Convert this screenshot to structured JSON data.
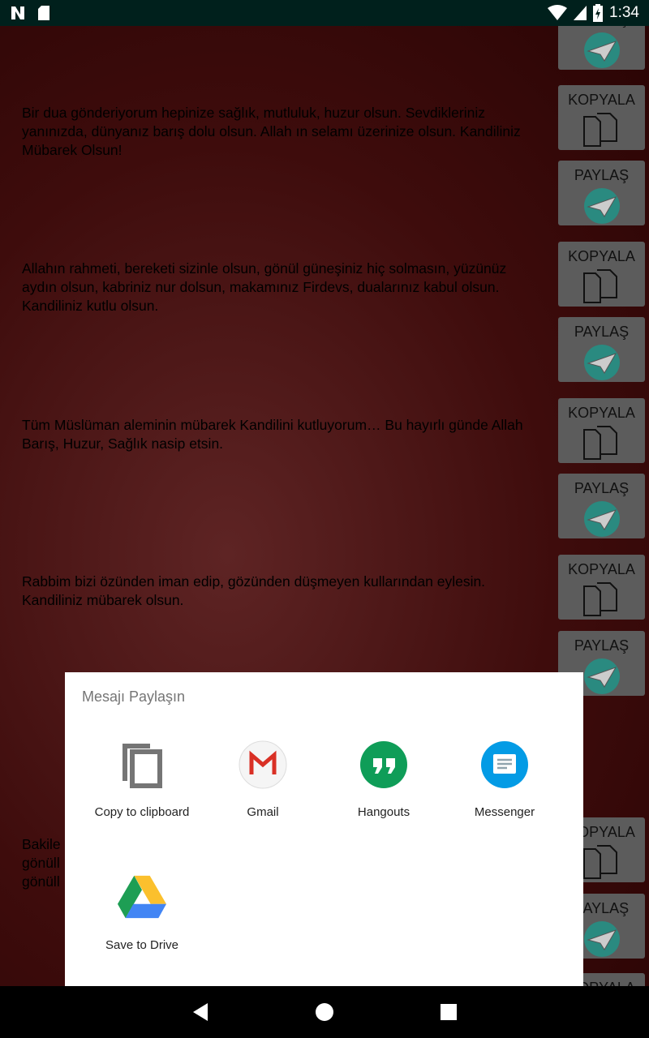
{
  "status_bar": {
    "time": "1:34",
    "icons": [
      "n-icon",
      "sd-card-icon",
      "wifi-icon",
      "signal-icon",
      "battery-charging-icon"
    ]
  },
  "messages": [
    "Bir dua gönderiyorum hepinize sağlık, mutluluk, huzur olsun. Sevdikleriniz yanınızda, dünyanız barış dolu olsun. Allah ın selamı üzerinize olsun. Kandiliniz Mübarek Olsun!",
    "Allahın rahmeti, bereketi sizinle olsun, gönül güneşiniz hiç solmasın, yüzünüz aydın olsun, kabriniz nur dolsun, makamınız Firdevs, dualarınız kabul olsun. Kandiliniz kutlu olsun.",
    "Tüm Müslüman aleminin mübarek Kandilini kutluyorum… Bu hayırlı günde Allah Barış, Huzur, Sağlık nasip etsin.",
    "Rabbim bizi özünden iman edip, gözünden düşmeyen kullarından eylesin. Kandiliniz mübarek olsun.",
    "Bakile\ngönüll\ngönüll"
  ],
  "buttons": {
    "copy": "KOPYALA",
    "share": "PAYLAŞ"
  },
  "share_sheet": {
    "title": "Mesajı Paylaşın",
    "targets": [
      {
        "label": "Copy to clipboard",
        "icon": "copy-icon"
      },
      {
        "label": "Gmail",
        "icon": "gmail-icon"
      },
      {
        "label": "Hangouts",
        "icon": "hangouts-icon"
      },
      {
        "label": "Messenger",
        "icon": "messenger-icon"
      },
      {
        "label": "Save to Drive",
        "icon": "drive-icon"
      }
    ]
  }
}
